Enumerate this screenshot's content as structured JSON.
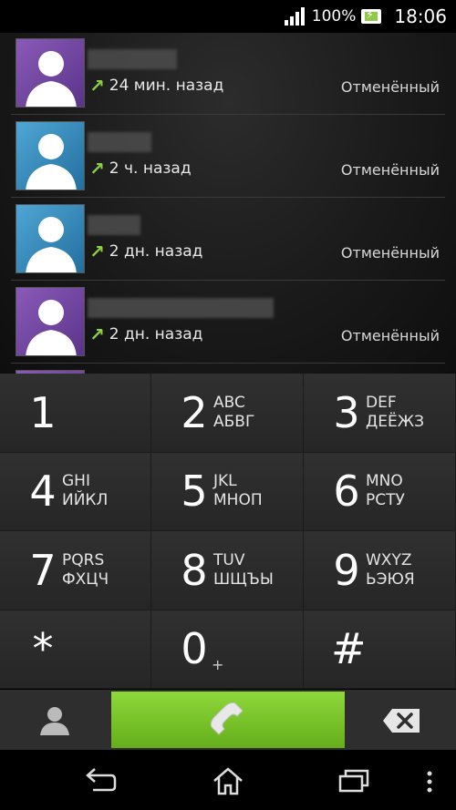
{
  "status_bar": {
    "battery_percent": "100%",
    "time": "18:06"
  },
  "call_log": [
    {
      "time": "24 мин. назад",
      "status": "Отменённый",
      "avatar_color": "#7a4aa8"
    },
    {
      "time": "2 ч. назад",
      "status": "Отменённый",
      "avatar_color": "#3a8fc0"
    },
    {
      "time": "2 дн. назад",
      "status": "Отменённый",
      "avatar_color": "#3a8fc0"
    },
    {
      "time": "2 дн. назад",
      "status": "Отменённый",
      "avatar_color": "#7a4aa8"
    }
  ],
  "dialpad": [
    {
      "digit": "1",
      "latin": "",
      "cyrillic": ""
    },
    {
      "digit": "2",
      "latin": "ABC",
      "cyrillic": "АБВГ"
    },
    {
      "digit": "3",
      "latin": "DEF",
      "cyrillic": "ДЕЁЖЗ"
    },
    {
      "digit": "4",
      "latin": "GHI",
      "cyrillic": "ИЙКЛ"
    },
    {
      "digit": "5",
      "latin": "JKL",
      "cyrillic": "МНОП"
    },
    {
      "digit": "6",
      "latin": "MNO",
      "cyrillic": "РСТУ"
    },
    {
      "digit": "7",
      "latin": "PQRS",
      "cyrillic": "ФХЦЧ"
    },
    {
      "digit": "8",
      "latin": "TUV",
      "cyrillic": "ШЩЪЫ"
    },
    {
      "digit": "9",
      "latin": "WXYZ",
      "cyrillic": "ЬЭЮЯ"
    },
    {
      "digit": "*",
      "latin": "",
      "cyrillic": ""
    },
    {
      "digit": "0",
      "latin": "+",
      "cyrillic": ""
    },
    {
      "digit": "#",
      "latin": "",
      "cyrillic": ""
    }
  ],
  "action_bar": {
    "call_color": "#7cc52a",
    "icons": [
      "contacts-icon",
      "phone-handset-icon",
      "backspace-icon"
    ]
  },
  "nav_bar": {
    "icons": [
      "back-icon",
      "home-icon",
      "recent-apps-icon",
      "overflow-menu-icon"
    ]
  }
}
